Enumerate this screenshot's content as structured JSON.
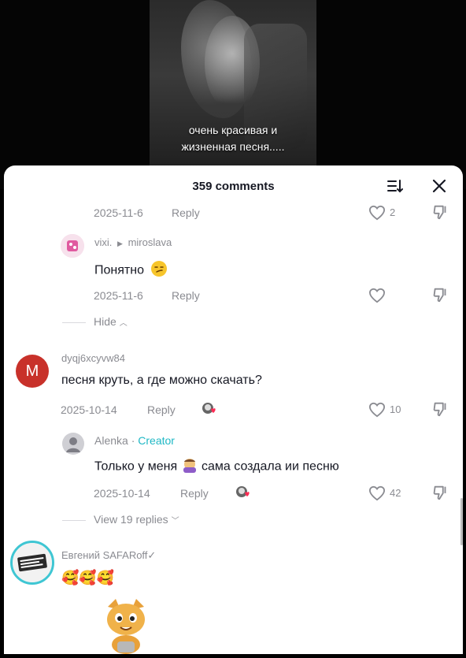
{
  "video": {
    "caption_line1": "очень красивая и",
    "caption_line2": "жизненная песня....."
  },
  "header": {
    "title": "359 comments",
    "sort_icon": "sort-descending-icon",
    "close_icon": "close-icon"
  },
  "comments": [
    {
      "date": "2025-11-6",
      "reply_label": "Reply",
      "like_count": "2"
    },
    {
      "user": "vixi.",
      "reply_to": "miroslava",
      "text": "Понятно",
      "date": "2025-11-6",
      "reply_label": "Reply",
      "toggle": "Hide"
    },
    {
      "avatar_letter": "M",
      "avatar_color": "#c8312a",
      "user": "dyqj6xcyvw84",
      "text": "песня круть, а где можно скачать?",
      "date": "2025-10-14",
      "reply_label": "Reply",
      "like_count": "10"
    },
    {
      "user": "Alenka",
      "badge_sep": "·",
      "badge": "Creator",
      "text_before": "Только у меня",
      "text_after": "сама создала ии песню",
      "date": "2025-10-14",
      "reply_label": "Reply",
      "like_count": "42",
      "toggle": "View 19 replies"
    },
    {
      "user": "Евгений SAFARoff✓",
      "emojis": "🥰🥰🥰"
    }
  ],
  "colors": {
    "text_primary": "#161823",
    "text_secondary": "#8a8b91",
    "creator": "#1fb8c5"
  }
}
